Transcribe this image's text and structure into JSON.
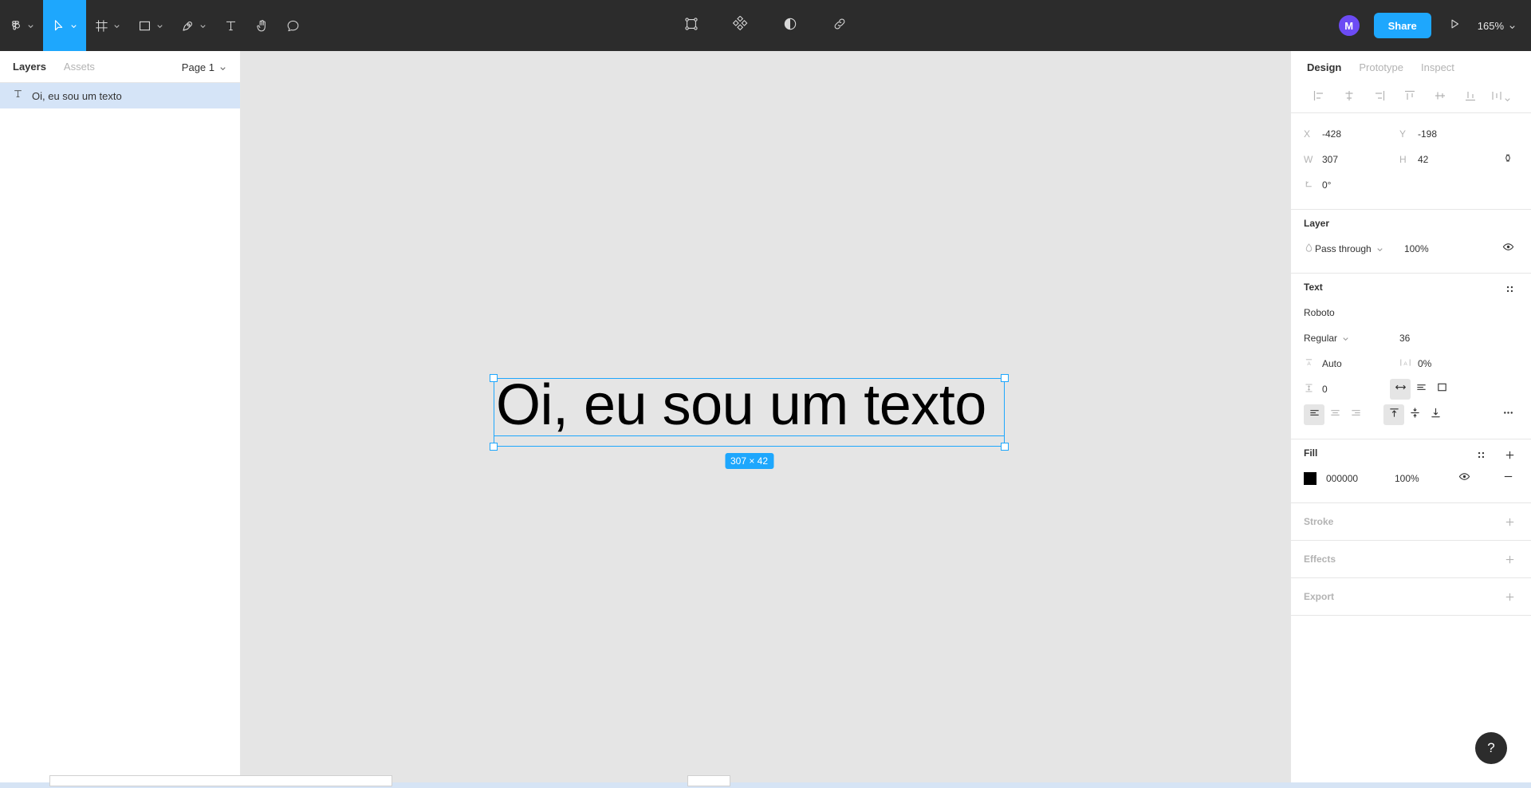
{
  "toolbar": {
    "left_tools": [
      {
        "name": "figma-menu",
        "icon": "figma-logo-icon",
        "has_chevron": true,
        "active": false
      },
      {
        "name": "move-tool",
        "icon": "cursor-icon",
        "has_chevron": true,
        "active": true
      },
      {
        "name": "frame-tool",
        "icon": "frame-icon",
        "has_chevron": true,
        "active": false
      },
      {
        "name": "shape-tool",
        "icon": "rectangle-icon",
        "has_chevron": true,
        "active": false
      },
      {
        "name": "pen-tool",
        "icon": "pen-icon",
        "has_chevron": true,
        "active": false
      },
      {
        "name": "text-tool",
        "icon": "text-icon",
        "has_chevron": false,
        "active": false
      },
      {
        "name": "hand-tool",
        "icon": "hand-icon",
        "has_chevron": false,
        "active": false
      },
      {
        "name": "comment-tool",
        "icon": "comment-icon",
        "has_chevron": false,
        "active": false
      }
    ],
    "center_tools": [
      {
        "name": "create-component",
        "icon": "component-icon"
      },
      {
        "name": "plugins",
        "icon": "plugins-diamond-icon"
      },
      {
        "name": "mask",
        "icon": "contrast-circle-icon"
      },
      {
        "name": "link",
        "icon": "link-icon"
      }
    ],
    "avatar_initial": "M",
    "avatar_color": "#6c4bf4",
    "share_label": "Share",
    "present_icon": "play-triangle-icon",
    "zoom_level": "165%",
    "accent_color": "#1ea7fd",
    "bg_color": "#2c2c2c"
  },
  "left_panel": {
    "tabs": [
      {
        "label": "Layers",
        "active": true
      },
      {
        "label": "Assets",
        "active": false
      }
    ],
    "page_selector": "Page 1",
    "layers": [
      {
        "icon": "text-layer-icon",
        "label": "Oi, eu sou um texto",
        "selected": true
      }
    ]
  },
  "canvas": {
    "text_content": "Oi, eu sou um texto",
    "size_badge": "307 × 42",
    "selection_color": "#1ea7fd",
    "background": "#e5e5e5"
  },
  "right_panel": {
    "tabs": [
      {
        "label": "Design",
        "active": true
      },
      {
        "label": "Prototype",
        "active": false
      },
      {
        "label": "Inspect",
        "active": false
      }
    ],
    "align_buttons": [
      "align-left-icon",
      "align-horizontal-center-icon",
      "align-right-icon",
      "align-top-icon",
      "align-vertical-center-icon",
      "align-bottom-icon",
      "distribute-icon"
    ],
    "position": {
      "x_label": "X",
      "x_value": "-428",
      "y_label": "Y",
      "y_value": "-198",
      "w_label": "W",
      "w_value": "307",
      "h_label": "H",
      "h_value": "42",
      "rotation_label": "rotation-icon",
      "rotation_value": "0°",
      "constrain_icon": "constrain-proportions-icon"
    },
    "layer": {
      "title": "Layer",
      "blend_icon": "blend-mode-icon",
      "blend_mode": "Pass through",
      "opacity": "100%",
      "visibility_icon": "eye-icon"
    },
    "text": {
      "title": "Text",
      "settings_icon": "four-dots-icon",
      "font_family": "Roboto",
      "font_weight": "Regular",
      "font_size": "36",
      "line_height_icon": "line-height-icon",
      "line_height": "Auto",
      "letter_spacing_icon": "letter-spacing-icon",
      "letter_spacing": "0%",
      "paragraph_spacing_icon": "paragraph-spacing-icon",
      "paragraph_spacing": "0",
      "resize_buttons": [
        {
          "icon": "auto-width-icon",
          "active": true
        },
        {
          "icon": "auto-height-icon",
          "active": false
        },
        {
          "icon": "fixed-size-icon",
          "active": false
        }
      ],
      "h_align_buttons": [
        {
          "icon": "text-align-left-icon",
          "active": true
        },
        {
          "icon": "text-align-center-icon",
          "active": false
        },
        {
          "icon": "text-align-right-icon",
          "active": false
        }
      ],
      "v_align_buttons": [
        {
          "icon": "align-text-top-icon",
          "active": true
        },
        {
          "icon": "align-text-middle-icon",
          "active": false
        },
        {
          "icon": "align-text-bottom-icon",
          "active": false
        }
      ],
      "more_icon": "ellipsis-icon"
    },
    "fill": {
      "title": "Fill",
      "settings_icon": "four-dots-icon",
      "add_icon": "plus-icon",
      "color_hex": "000000",
      "color_value": "#000000",
      "opacity": "100%",
      "visibility_icon": "eye-icon",
      "remove_icon": "minus-icon"
    },
    "stroke": {
      "title": "Stroke",
      "add_icon": "plus-icon"
    },
    "effects": {
      "title": "Effects",
      "add_icon": "plus-icon"
    },
    "export": {
      "title": "Export",
      "add_icon": "plus-icon"
    },
    "help_label": "?"
  }
}
